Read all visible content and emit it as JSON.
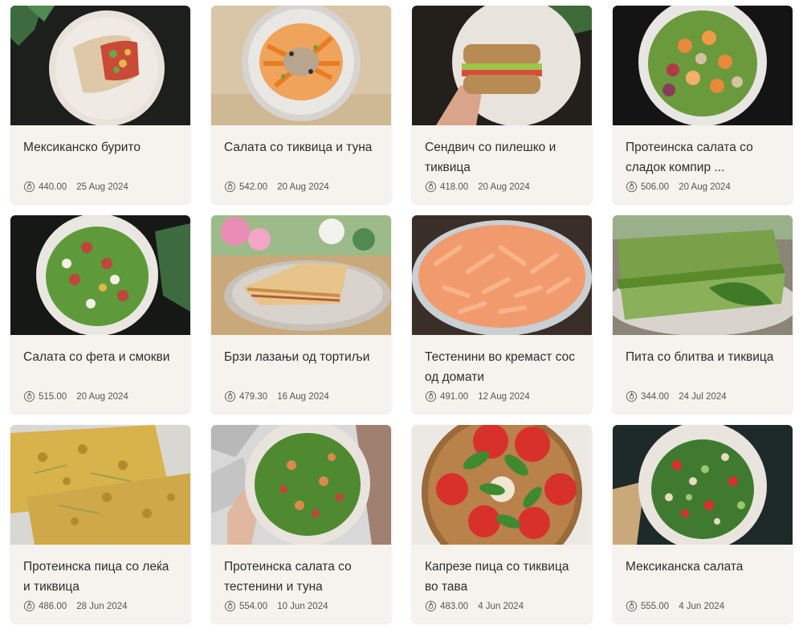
{
  "recipes": [
    {
      "title": "Мексиканско бурито",
      "calories": "440.00",
      "date": "25 Aug 2024",
      "image": "burrito-photo"
    },
    {
      "title": "Салата со тиквица и туна",
      "calories": "542.00",
      "date": "20 Aug 2024",
      "image": "zucchini-tuna-salad-photo"
    },
    {
      "title": "Сендвич со пилешко и тиквица",
      "calories": "418.00",
      "date": "20 Aug 2024",
      "image": "chicken-sandwich-photo"
    },
    {
      "title": "Протеинска салата со сладок компир ...",
      "calories": "506.00",
      "date": "20 Aug 2024",
      "image": "sweet-potato-salad-photo"
    },
    {
      "title": "Салата со фета и смокви",
      "calories": "515.00",
      "date": "20 Aug 2024",
      "image": "feta-fig-salad-photo"
    },
    {
      "title": "Брзи лазањи од тортиљи",
      "calories": "479.30",
      "date": "16 Aug 2024",
      "image": "tortilla-lasagna-photo"
    },
    {
      "title": "Тестенини во кремаст сос од домати",
      "calories": "491.00",
      "date": "12 Aug 2024",
      "image": "penne-tomato-photo"
    },
    {
      "title": "Пита со блитва и тиквица",
      "calories": "344.00",
      "date": "24 Jul 2024",
      "image": "chard-pie-photo"
    },
    {
      "title": "Протеинска пица со леќа и тиквица",
      "calories": "486.00",
      "date": "28 Jun 2024",
      "image": "lentil-pizza-photo"
    },
    {
      "title": "Протеинска салата со тестенини и туна",
      "calories": "554.00",
      "date": "10 Jun 2024",
      "image": "pasta-tuna-salad-photo"
    },
    {
      "title": "Капрезе пица со тиквица во тава",
      "calories": "483.00",
      "date": "4 Jun 2024",
      "image": "caprese-pizza-photo"
    },
    {
      "title": "Мексиканска салата",
      "calories": "555.00",
      "date": "4 Jun 2024",
      "image": "mexican-salad-photo"
    }
  ],
  "icons": {
    "calories": "flame-icon"
  },
  "colors": {
    "card_bg": "#f6f3ee",
    "text": "#2d2d2d",
    "meta": "#555555"
  }
}
